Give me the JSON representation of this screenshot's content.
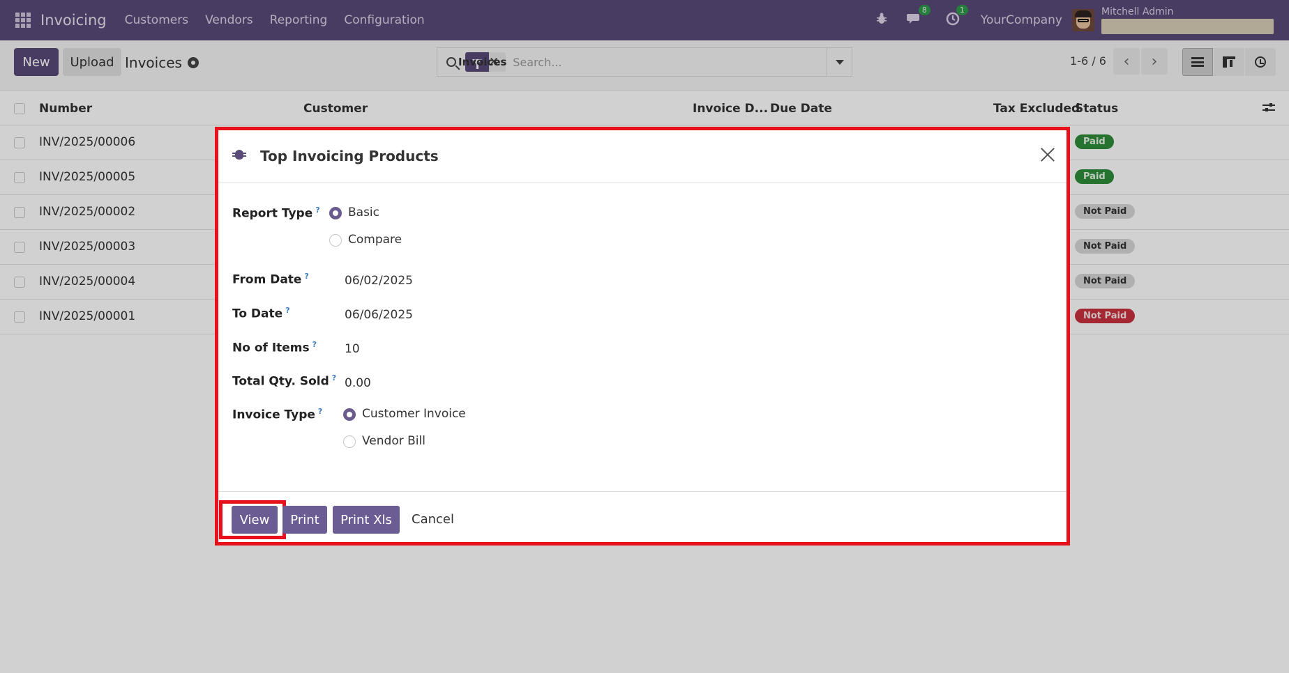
{
  "navbar": {
    "app_name": "Invoicing",
    "menu": [
      "Customers",
      "Vendors",
      "Reporting",
      "Configuration"
    ],
    "messages_count": "8",
    "activities_count": "1",
    "company": "YourCompany",
    "user_name": "Mitchell Admin"
  },
  "control": {
    "new_label": "New",
    "upload_label": "Upload",
    "breadcrumb": "Invoices",
    "search_facet": "Invoices",
    "search_placeholder": "Search...",
    "pager": "1-6 / 6"
  },
  "table": {
    "columns": {
      "number": "Number",
      "customer": "Customer",
      "invoice_date": "Invoice D...",
      "due_date": "Due Date",
      "tax_excluded": "Tax Excluded",
      "status": "Status"
    },
    "rows": [
      {
        "number": "INV/2025/00006",
        "status": "Paid"
      },
      {
        "number": "INV/2025/00005",
        "status": "Paid"
      },
      {
        "number": "INV/2025/00002",
        "status": "Not Paid"
      },
      {
        "number": "INV/2025/00003",
        "status": "Not Paid"
      },
      {
        "number": "INV/2025/00004",
        "status": "Not Paid"
      },
      {
        "number": "INV/2025/00001",
        "status": "Not Paid"
      }
    ]
  },
  "modal": {
    "title": "Top Invoicing Products",
    "report_type_label": "Report Type",
    "report_type_options": [
      "Basic",
      "Compare"
    ],
    "report_type_selected": "Basic",
    "from_date_label": "From Date",
    "from_date": "06/02/2025",
    "to_date_label": "To Date",
    "to_date": "06/06/2025",
    "no_items_label": "No of Items",
    "no_items": "10",
    "total_qty_label": "Total Qty. Sold",
    "total_qty": "0.00",
    "invoice_type_label": "Invoice Type",
    "invoice_type_options": [
      "Customer Invoice",
      "Vendor Bill"
    ],
    "invoice_type_selected": "Customer Invoice",
    "help_mark": "?",
    "buttons": {
      "view": "View",
      "print": "Print",
      "print_xls": "Print Xls",
      "cancel": "Cancel"
    }
  },
  "colors": {
    "navbar": "#5a4a78",
    "primary_button": "#6c5c94",
    "highlight": "#e8101a",
    "paid": "#2f8c3a",
    "not_paid_overdue": "#c8303c"
  }
}
